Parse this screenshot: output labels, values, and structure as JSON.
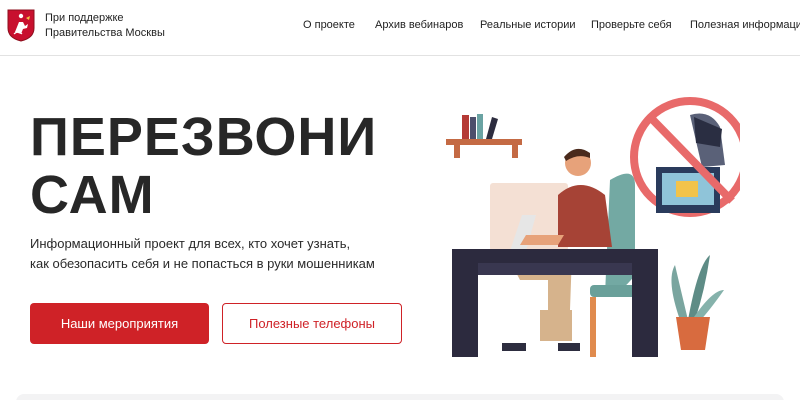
{
  "header": {
    "brand_line1": "При поддержке",
    "brand_line2": "Правительства Москвы",
    "nav": [
      {
        "label": "О проекте"
      },
      {
        "label": "Архив вебинаров"
      },
      {
        "label": "Реальные истории"
      },
      {
        "label": "Проверьте себя"
      },
      {
        "label": "Полезная информация"
      }
    ]
  },
  "hero": {
    "title_line1": "ПЕРЕЗВОНИ",
    "title_line2": "САМ",
    "subtitle_line1": "Информационный проект для всех, кто хочет узнать,",
    "subtitle_line2": "как обезопасить себя и не попасться в руки мошенникам",
    "primary_button": "Наши мероприятия",
    "secondary_button": "Полезные телефоны"
  },
  "colors": {
    "accent": "#cf2227",
    "title": "#272727",
    "divider": "#e2e2e2"
  },
  "icons": {
    "brand": "moscow-coat-of-arms-icon",
    "illustration": "man-at-computer-with-crossed-out-hacker"
  }
}
